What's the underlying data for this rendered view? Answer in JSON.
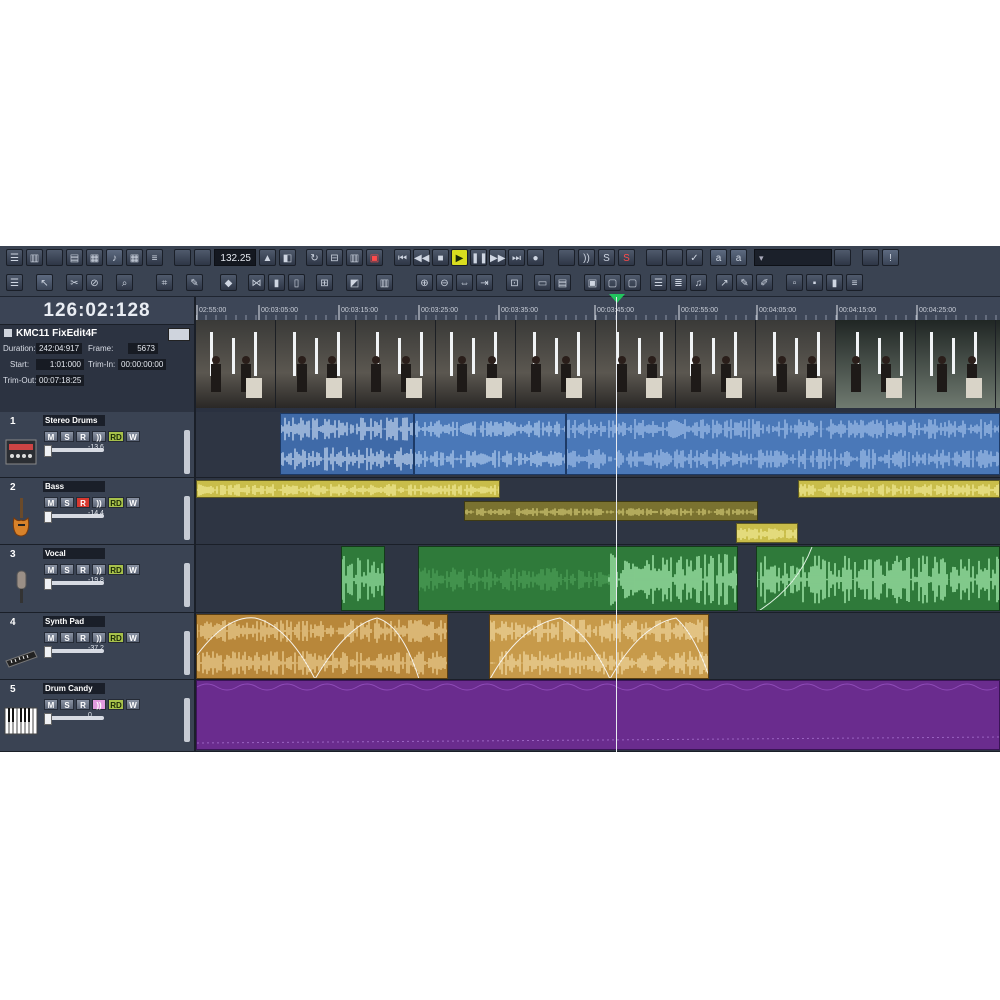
{
  "transport": {
    "tempo": "132.25"
  },
  "main_time": "126:02:128",
  "clip_info": {
    "name": "KMC11 FixEdit4F",
    "duration_label": "Duration:",
    "duration": "242:04:917",
    "frame_label": "Frame:",
    "frame": "5673",
    "start_label": "Start:",
    "start": "1:01:000",
    "trim_in_label": "Trim-In:",
    "trim_in": "00:00:00:00",
    "trim_out_label": "Trim-Out:",
    "trim_out": "00:07:18:25"
  },
  "ruler": {
    "ticks": [
      "02:55:00",
      "00:03:05:00",
      "00:03:15:00",
      "00:03:25:00",
      "00:03:35:00",
      "00:03:45:00",
      "00:02:55:00",
      "00:04:05:00",
      "00:04:15:00",
      "00:04:25:00"
    ]
  },
  "track_buttons": {
    "mute": "M",
    "solo": "S",
    "rec": "R",
    "monitor": "))",
    "read": "RD",
    "write": "W"
  },
  "tracks": [
    {
      "number": "1",
      "name": "Stereo Drums",
      "volume": "-13.6",
      "icon": "drum-machine-icon"
    },
    {
      "number": "2",
      "name": "Bass",
      "volume": "-14.4",
      "icon": "bass-guitar-icon",
      "armed": true
    },
    {
      "number": "3",
      "name": "Vocal",
      "volume": "-19.8",
      "icon": "microphone-icon"
    },
    {
      "number": "4",
      "name": "Synth Pad",
      "volume": "-37.2",
      "icon": "synthesizer-icon"
    },
    {
      "number": "5",
      "name": "Drum Candy",
      "volume": "0",
      "icon": "piano-keys-icon"
    }
  ],
  "colors": {
    "drums": "#4a78b8",
    "bass": "#c9bd4a",
    "vocal": "#2f7a3a",
    "synth": "#b8873a",
    "candy": "#6a2c8e",
    "playhead_marker": "#22c55e"
  }
}
